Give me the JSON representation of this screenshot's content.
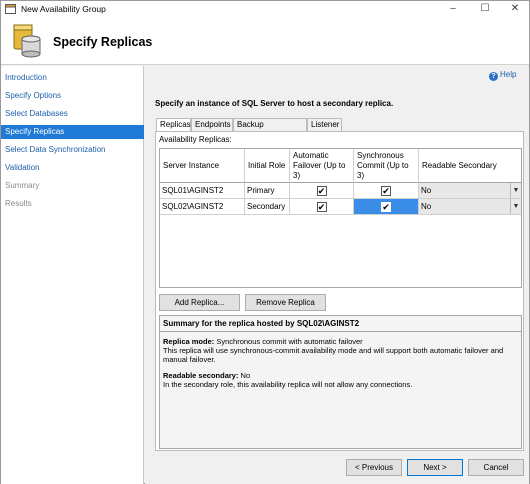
{
  "window": {
    "title": "New Availability Group",
    "minimize": "–",
    "maximize": "☐",
    "close": "✕"
  },
  "header": {
    "title": "Specify Replicas"
  },
  "sidebar": {
    "items": [
      {
        "label": "Introduction",
        "state": "link"
      },
      {
        "label": "Specify Options",
        "state": "link"
      },
      {
        "label": "Select Databases",
        "state": "link"
      },
      {
        "label": "Specify Replicas",
        "state": "active"
      },
      {
        "label": "Select Data Synchronization",
        "state": "link"
      },
      {
        "label": "Validation",
        "state": "link"
      },
      {
        "label": "Summary",
        "state": "disabled"
      },
      {
        "label": "Results",
        "state": "disabled"
      }
    ]
  },
  "main": {
    "help": "Help",
    "instruction": "Specify an instance of SQL Server to host a secondary replica.",
    "tabs": [
      "Replicas",
      "Endpoints",
      "Backup Preferences",
      "Listener"
    ],
    "active_tab": "Replicas",
    "replicas_label": "Availability Replicas:",
    "columns": [
      "Server Instance",
      "Initial Role",
      "Automatic Failover (Up to 3)",
      "Synchronous Commit (Up to 3)",
      "Readable Secondary"
    ],
    "rows": [
      {
        "server": "SQL01\\AGINST2",
        "role": "Primary",
        "auto_failover": true,
        "sync_commit": true,
        "readable": "No"
      },
      {
        "server": "SQL02\\AGINST2",
        "role": "Secondary",
        "auto_failover": true,
        "sync_commit": true,
        "readable": "No"
      }
    ],
    "check_glyph": "✔",
    "add_replica": "Add Replica...",
    "remove_replica": "Remove Replica",
    "summary": {
      "title": "Summary for the replica hosted by SQL02\\AGINST2",
      "replica_mode_label": "Replica mode:",
      "replica_mode_value": "Synchronous commit with automatic failover",
      "replica_mode_desc": "This replica will use synchronous-commit availability mode and will support both automatic failover and manual failover.",
      "readable_label": "Readable secondary:",
      "readable_value": "No",
      "readable_desc": "In the secondary role, this availability replica will not allow any connections."
    }
  },
  "footer": {
    "previous": "< Previous",
    "next": "Next >",
    "cancel": "Cancel"
  },
  "colors": {
    "accent": "#1e7ad6",
    "link": "#1d5fa8",
    "selected_cell": "#3b8ee8"
  }
}
